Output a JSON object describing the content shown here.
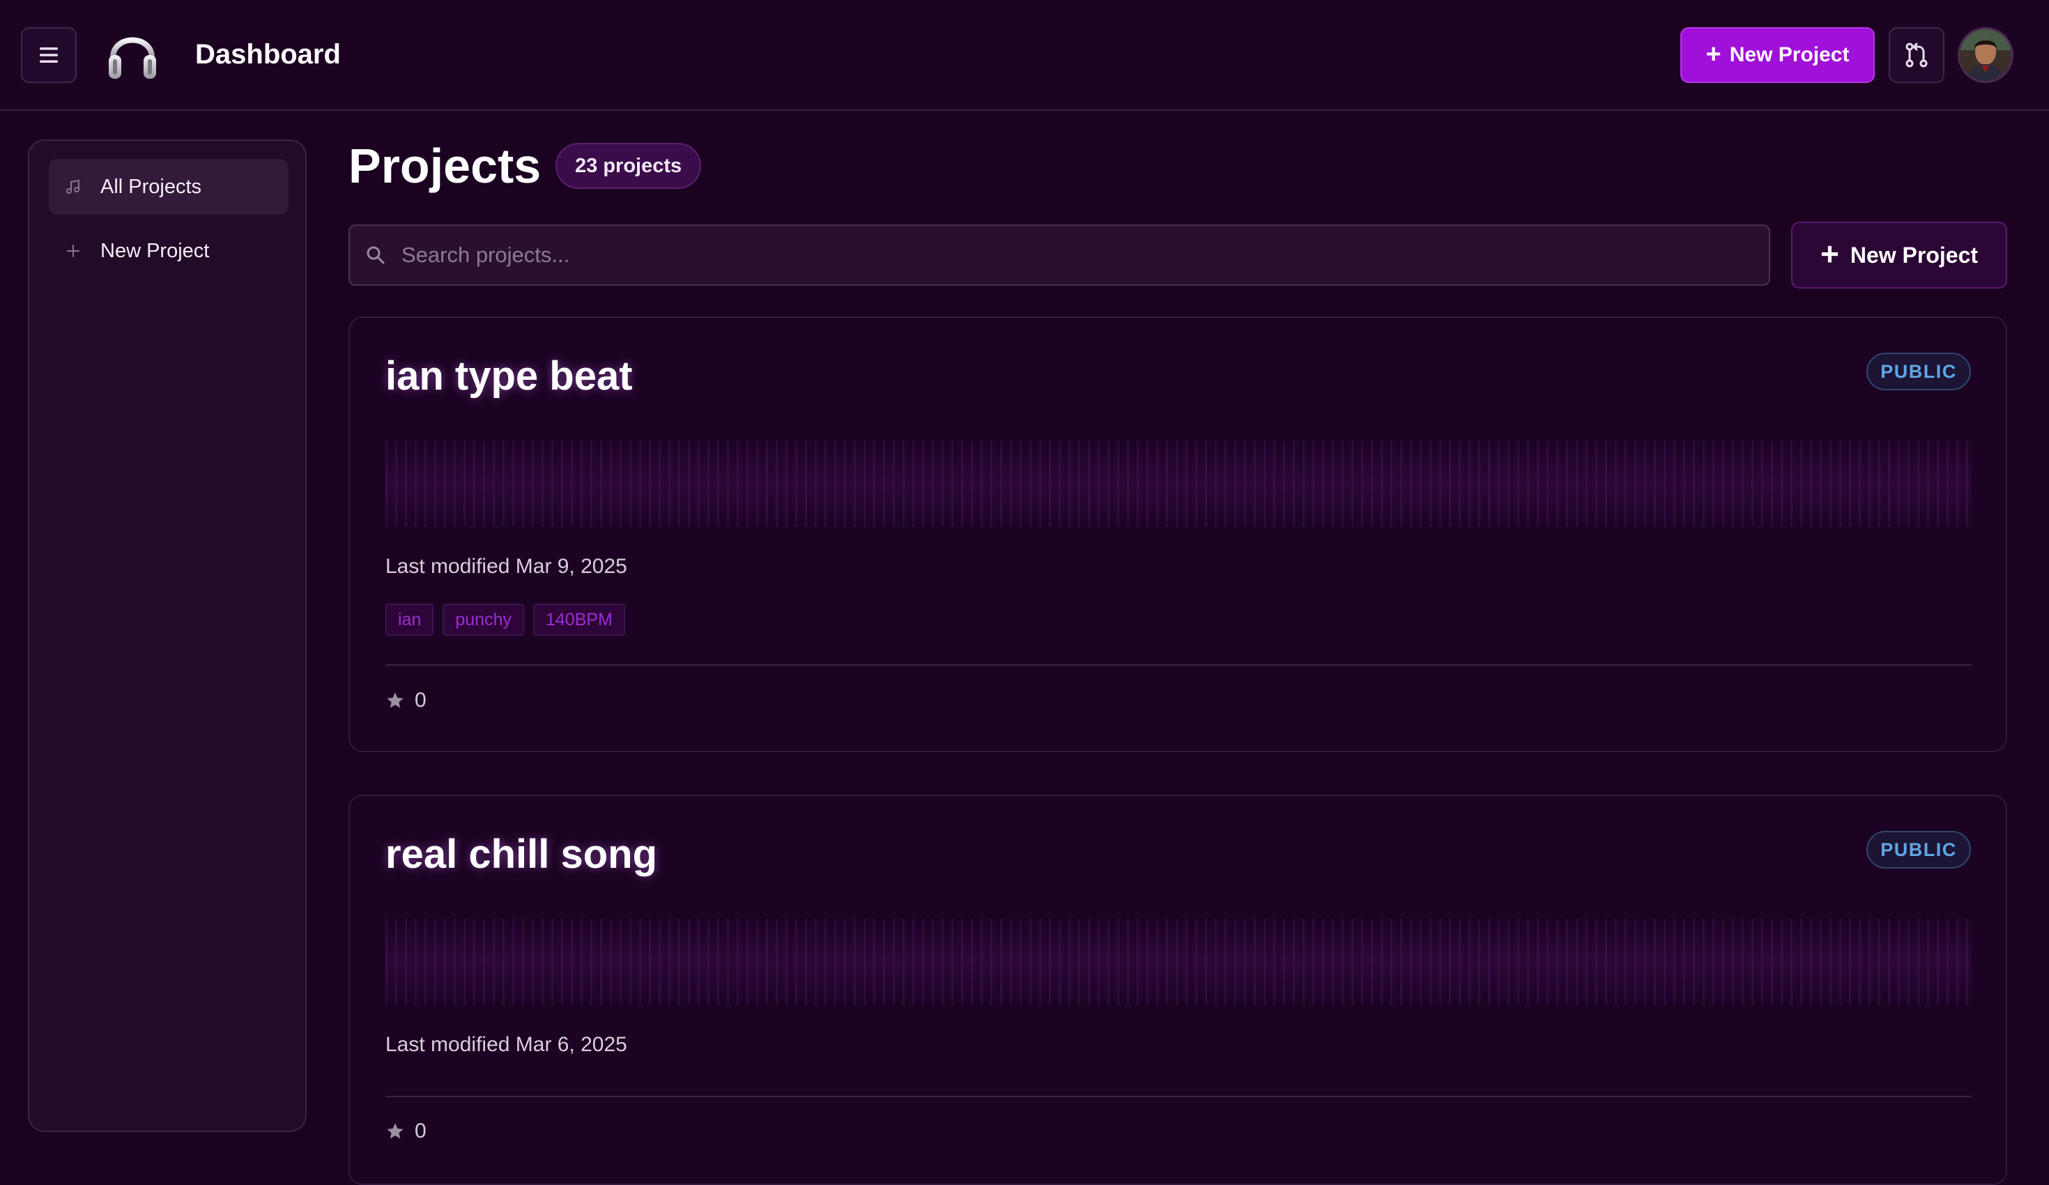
{
  "header": {
    "title": "Dashboard",
    "new_project_label": "New Project",
    "menu_icon": "hamburger-icon",
    "logo_icon": "headphones-logo",
    "git_icon": "git-pull-request-icon"
  },
  "sidebar": {
    "items": [
      {
        "label": "All Projects",
        "icon": "music-note-icon",
        "active": true
      },
      {
        "label": "New Project",
        "icon": "plus-icon",
        "active": false
      }
    ]
  },
  "main": {
    "title": "Projects",
    "count_label": "23 projects",
    "search": {
      "placeholder": "Search projects...",
      "value": ""
    },
    "new_project_label": "New Project"
  },
  "projects": [
    {
      "title": "ian type beat",
      "visibility": "PUBLIC",
      "modified": "Last modified Mar 9, 2025",
      "tags": [
        "ian",
        "punchy",
        "140BPM"
      ],
      "stars": "0"
    },
    {
      "title": "real chill song",
      "visibility": "PUBLIC",
      "modified": "Last modified Mar 6, 2025",
      "tags": [],
      "stars": "0"
    }
  ],
  "colors": {
    "background": "#1a0220",
    "accent": "#a010d8",
    "tag_text": "#9d2dd3",
    "public_badge": "#5fa6e6"
  }
}
